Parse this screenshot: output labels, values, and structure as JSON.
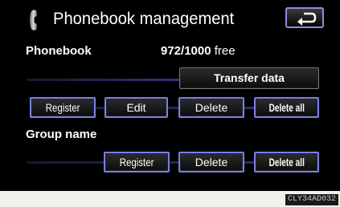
{
  "header": {
    "title": "Phonebook management"
  },
  "phonebook": {
    "label": "Phonebook",
    "count": "972/1000",
    "free_label": "free",
    "transfer_label": "Transfer data",
    "register_label": "Register",
    "edit_label": "Edit",
    "delete_label": "Delete",
    "delete_all_label": "Delete all"
  },
  "group": {
    "label": "Group name",
    "register_label": "Register",
    "delete_label": "Delete",
    "delete_all_label": "Delete all"
  },
  "footer": {
    "code": "CLY34AD032"
  },
  "colors": {
    "screen_bg": "#000000",
    "button_border_selected": "#7a80e6",
    "footer_bg": "#f1f0ea"
  },
  "icons": {
    "title_icon": "phone-handset-icon",
    "back_icon": "return-arrow-icon"
  }
}
